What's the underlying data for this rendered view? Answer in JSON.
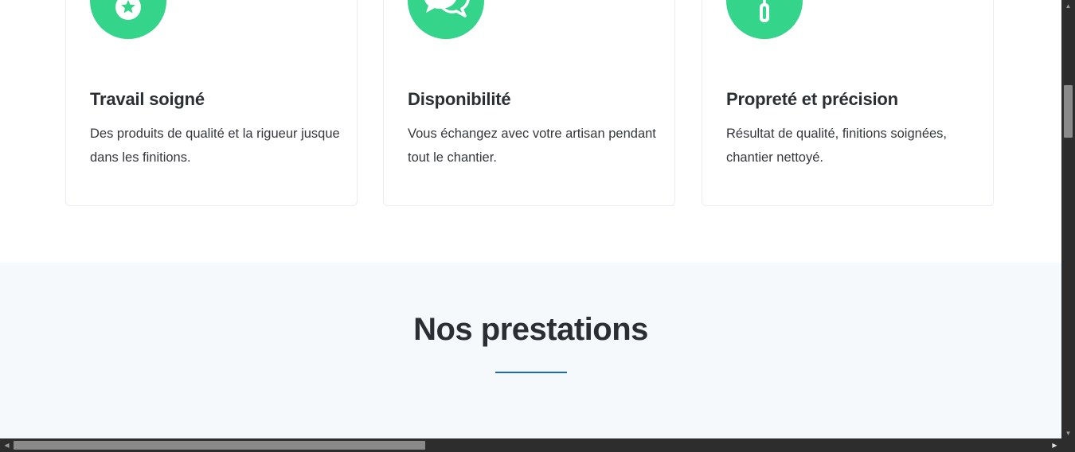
{
  "features": {
    "cards": [
      {
        "icon": "medal-icon",
        "title": "Travail soigné",
        "text": "Des produits de qualité et la rigueur jusque dans les finitions."
      },
      {
        "icon": "chat-bubbles-icon",
        "title": "Disponibilité",
        "text": "Vous échangez avec votre artisan pendant tout le chantier."
      },
      {
        "icon": "paint-roller-icon",
        "title": "Propreté et précision",
        "text": "Résultat de qualité, finitions soignées, chantier nettoyé."
      }
    ]
  },
  "prestations": {
    "title": "Nos prestations"
  },
  "colors": {
    "accent_green": "#34d48a",
    "accent_blue": "#1a66c9",
    "section_background": "#f6f9fc",
    "text": "#2b2f33"
  }
}
